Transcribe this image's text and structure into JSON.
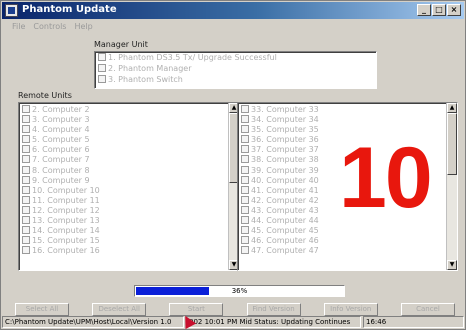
{
  "window": {
    "title": "Phantom Update"
  },
  "menu": {
    "items": [
      "File",
      "Controls",
      "Help"
    ]
  },
  "manager_unit": {
    "label": "Manager Unit",
    "items": [
      "1. Phantom DS3.5 Tx/  Upgrade Successful",
      "2. Phantom Manager",
      "3. Phantom Switch"
    ]
  },
  "remote_units": {
    "label": "Remote Units",
    "left_items": [
      "2. Computer 2",
      "3. Computer 3",
      "4. Computer 4",
      "5. Computer 5",
      "6. Computer 6",
      "7. Computer 7",
      "8. Computer 8",
      "9. Computer 9",
      "10. Computer 10",
      "11. Computer 11",
      "12. Computer 12",
      "13. Computer 13",
      "14. Computer 14",
      "15. Computer 15",
      "16. Computer 16"
    ],
    "right_items": [
      "33. Computer 33",
      "34. Computer 34",
      "35. Computer 35",
      "36. Computer 36",
      "37. Computer 37",
      "38. Computer 38",
      "39. Computer 39",
      "40. Computer 40",
      "41. Computer 41",
      "42. Computer 42",
      "43. Computer 43",
      "44. Computer 44",
      "45. Computer 45",
      "46. Computer 46",
      "47. Computer 47"
    ]
  },
  "progress": {
    "value": 0.36,
    "label": "36%"
  },
  "buttons": [
    "Select All",
    "Deselect All",
    "Start",
    "Find Version",
    "Info Version",
    "Cancel"
  ],
  "status_bar": {
    "file": "C:\\Phantom Update\\UPM\\Host\\Local\\Version 1.0",
    "info": "002 10:01 PM  Mid  Status: Updating Continues",
    "time": "16:46"
  },
  "overlay": {
    "number": "10",
    "color": "#e8170d"
  },
  "colors": {
    "title_start": "#0a246a",
    "progress_fill": "#0a1fd8"
  }
}
